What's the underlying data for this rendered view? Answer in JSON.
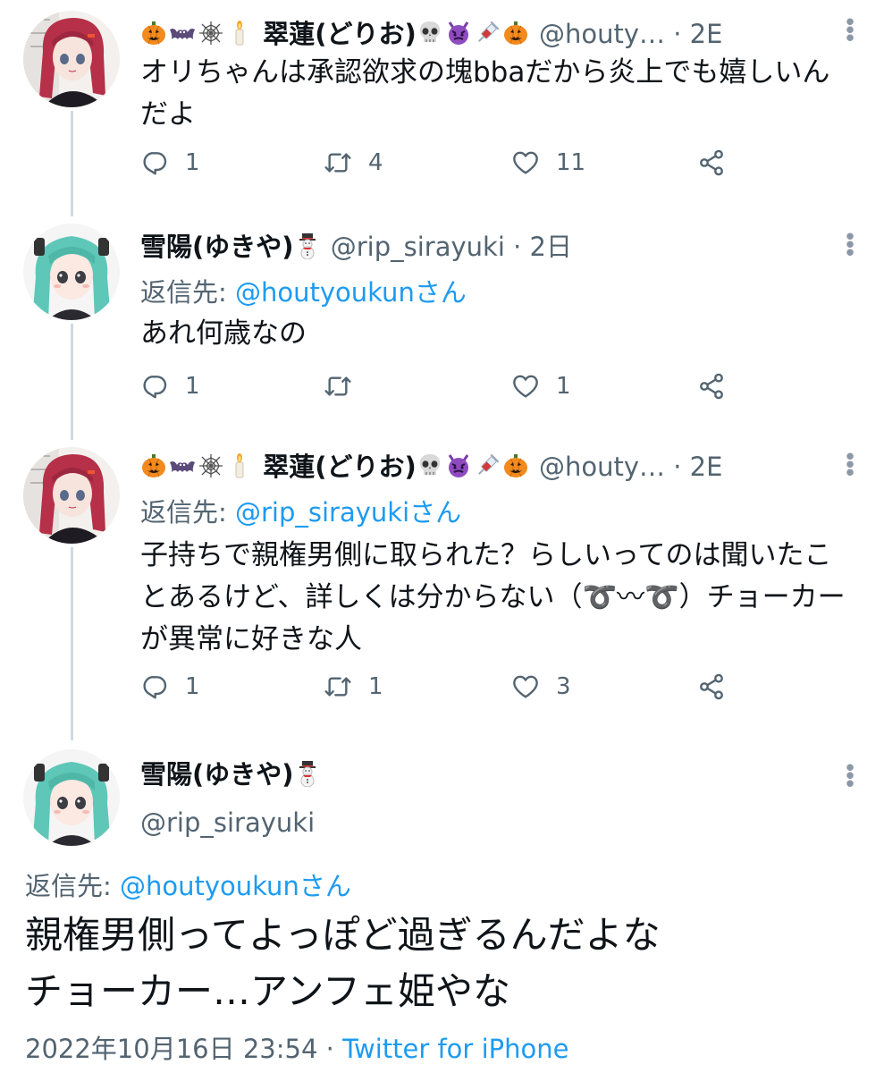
{
  "tweets": [
    {
      "name": "翠蓮(どりお)",
      "handle": "@houty…",
      "time": "2E",
      "body": "オリちゃんは承認欲求の塊bbaだから炎上でも嬉しいんだよ",
      "counts": {
        "reply": "1",
        "retweet": "4",
        "like": "11"
      }
    },
    {
      "name": "雪陽(ゆきや)",
      "handle": "@rip_sirayuki",
      "time": "2日",
      "reply_label": "返信先:",
      "reply_target": "@houtyoukunさん",
      "body": "あれ何歳なの",
      "counts": {
        "reply": "1",
        "retweet": "",
        "like": "1"
      }
    },
    {
      "name": "翠蓮(どりお)",
      "handle": "@houty…",
      "time": "2E",
      "reply_label": "返信先:",
      "reply_target": "@rip_sirayukiさん",
      "body": "子持ちで親権男側に取られた？らしいってのは聞いたことあるけど、詳しくは分からない（➰〰➰）チョーカーが異常に好きな人",
      "counts": {
        "reply": "1",
        "retweet": "1",
        "like": "3"
      }
    }
  ],
  "main": {
    "name": "雪陽(ゆきや)",
    "handle": "@rip_sirayuki",
    "reply_label": "返信先:",
    "reply_target": "@houtyoukunさん",
    "body_line1": "親権男側ってよっぽど過ぎるんだよな",
    "body_line2": "チョーカー…アンフェ姫やな",
    "timestamp": "2022年10月16日 23:54",
    "separator": "·",
    "source": "Twitter for iPhone"
  },
  "icons": [
    "pumpkin-icon",
    "bat-icon",
    "spiderweb-icon",
    "candle-icon",
    "skull-icon",
    "devil-icon",
    "syringe-icon",
    "snowman-icon",
    "reply-icon",
    "retweet-icon",
    "like-icon",
    "share-icon",
    "more-icon"
  ],
  "colors": {
    "link": "#1d9bf0",
    "secondary": "#536471",
    "thread": "#cfd9de"
  }
}
